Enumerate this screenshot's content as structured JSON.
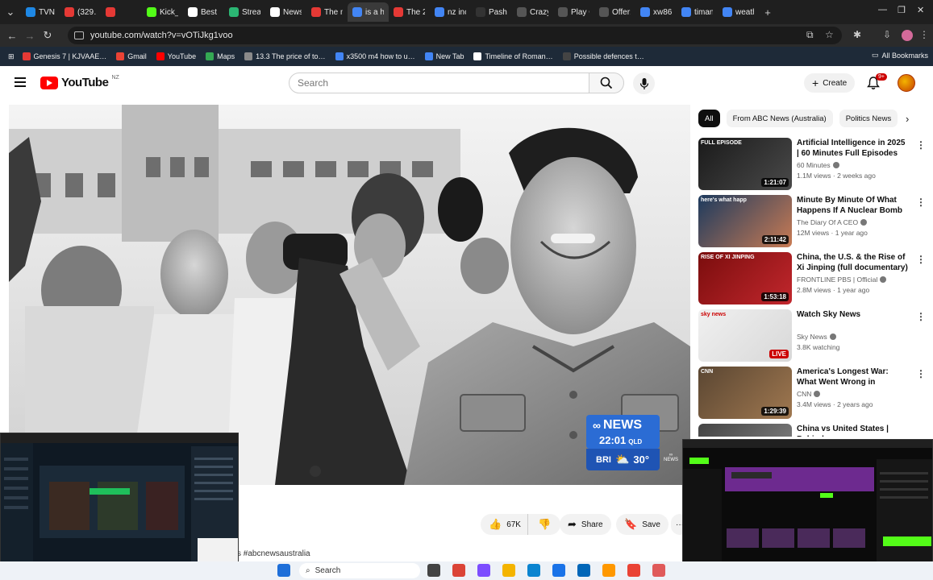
{
  "browser": {
    "tabs": [
      {
        "label": "TVNZ",
        "color": "#1e88e5"
      },
      {
        "label": "(329…",
        "color": "#e53935"
      },
      {
        "label": "",
        "color": "#e53935"
      },
      {
        "label": "Kick_",
        "color": "#53fc18"
      },
      {
        "label": "Best c",
        "color": "#ffffff"
      },
      {
        "label": "Strea",
        "color": "#2bb673"
      },
      {
        "label": "News",
        "color": "#ffffff"
      },
      {
        "label": "The m",
        "color": "#e53935"
      },
      {
        "label": "is a h",
        "color": "#4285f4"
      },
      {
        "label": "The 2",
        "color": "#e53935"
      },
      {
        "label": "nz inc",
        "color": "#4285f4"
      },
      {
        "label": "Pashe",
        "color": "#333333"
      },
      {
        "label": "Crazy",
        "color": "#555555"
      },
      {
        "label": "Play C",
        "color": "#555555"
      },
      {
        "label": "Offer:",
        "color": "#555555"
      },
      {
        "label": "xw86",
        "color": "#4285f4"
      },
      {
        "label": "timan",
        "color": "#4285f4"
      },
      {
        "label": "weath",
        "color": "#4285f4"
      }
    ],
    "new_tab": "+",
    "url": "youtube.com/watch?v=vOTiJkg1voo",
    "bookmarks": [
      {
        "label": "Genesis 7 | KJVAAE…",
        "color": "#e53935"
      },
      {
        "label": "Gmail",
        "color": "#ea4335"
      },
      {
        "label": "YouTube",
        "color": "#ff0000"
      },
      {
        "label": "Maps",
        "color": "#34a853"
      },
      {
        "label": "13.3 The price of to…",
        "color": "#8a8a8a"
      },
      {
        "label": "x3500 m4 how to u…",
        "color": "#4285f4"
      },
      {
        "label": "New Tab",
        "color": "#4285f4"
      },
      {
        "label": "Timeline of Roman…",
        "color": "#ffffff"
      },
      {
        "label": "Possible defences t…",
        "color": "#444444"
      }
    ],
    "all_bookmarks": "All Bookmarks"
  },
  "youtube": {
    "logo_word": "YouTube",
    "region": "NZ",
    "search_placeholder": "Search",
    "create_label": "Create",
    "notifications_badge": "9+"
  },
  "video": {
    "abc_brand": "NEWS",
    "abc_time": "22:01",
    "abc_timezone": "QLD",
    "abc_city": "BRI",
    "abc_temp": "30°",
    "likes": "67K",
    "share_label": "Share",
    "save_label": "Save",
    "more_label": "···",
    "hashtags": "s #abcnewsaustralia"
  },
  "sidebar": {
    "chips": [
      "All",
      "From ABC News (Australia)",
      "Politics News"
    ],
    "recommendations": [
      {
        "title": "Artificial Intelligence in 2025 | 60 Minutes Full Episodes",
        "channel": "60 Minutes",
        "meta": "1.1M views · 2 weeks ago",
        "duration": "1:21:07",
        "thumb_badge": "FULL EPISODE",
        "color_a": "#1a1a1a",
        "color_b": "#4a4a4a"
      },
      {
        "title": "Minute By Minute Of What Happens If A Nuclear Bomb …",
        "channel": "The Diary Of A CEO",
        "meta": "12M views · 1 year ago",
        "duration": "2:11:42",
        "thumb_badge": "here's what happ",
        "color_a": "#1c3a5e",
        "color_b": "#c97b54"
      },
      {
        "title": "China, the U.S. & the Rise of Xi Jinping (full documentary) | …",
        "channel": "FRONTLINE PBS | Official",
        "meta": "2.8M views · 1 year ago",
        "duration": "1:53:18",
        "thumb_badge": "RISE OF XI JINPING",
        "color_a": "#7a0d0d",
        "color_b": "#c2272d"
      },
      {
        "title": "Watch Sky News",
        "channel": "Sky News",
        "meta": "3.8K watching",
        "duration": "LIVE",
        "thumb_badge": "sky news",
        "color_a": "#f0f0f0",
        "color_b": "#d8d8d8"
      },
      {
        "title": "America's Longest War: What Went Wrong in Afghanistan …",
        "channel": "CNN",
        "meta": "3.4M views · 2 years ago",
        "duration": "1:29:39",
        "thumb_badge": "CNN",
        "color_a": "#5a4632",
        "color_b": "#a07850"
      },
      {
        "title": "China vs United States | Behind",
        "channel": "",
        "meta": "",
        "duration": "",
        "thumb_badge": "",
        "color_a": "#444444",
        "color_b": "#888888"
      }
    ]
  },
  "taskbar": {
    "search_label": "Search"
  }
}
